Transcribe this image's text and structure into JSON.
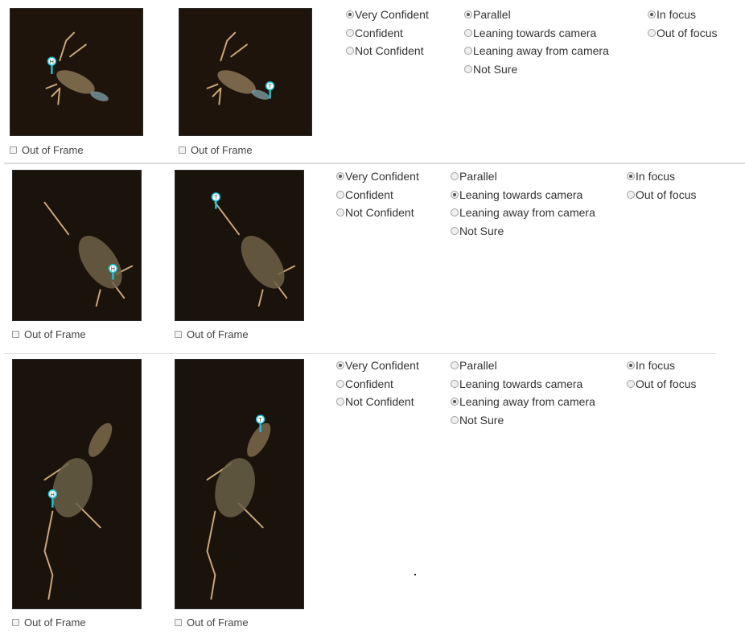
{
  "out_of_frame_label": "Out of Frame",
  "confidence_options": [
    "Very Confident",
    "Confident",
    "Not Confident"
  ],
  "orientation_options": [
    "Parallel",
    "Leaning towards camera",
    "Leaning away from camera",
    "Not Sure"
  ],
  "focus_options": [
    "In focus",
    "Out of focus"
  ],
  "rows": [
    {
      "head_marker": "H",
      "tail_marker": "T",
      "selected": {
        "confidence": "Very Confident",
        "orientation": "Parallel",
        "focus": "In focus"
      },
      "out_of_frame_head": false,
      "out_of_frame_tail": false
    },
    {
      "head_marker": "H",
      "tail_marker": "T",
      "selected": {
        "confidence": "Very Confident",
        "orientation": "Leaning towards camera",
        "focus": "In focus"
      },
      "out_of_frame_head": false,
      "out_of_frame_tail": false
    },
    {
      "head_marker": "H",
      "tail_marker": "T",
      "selected": {
        "confidence": "Very Confident",
        "orientation": "Leaning away from camera",
        "focus": "In focus"
      },
      "out_of_frame_head": false,
      "out_of_frame_tail": false
    }
  ],
  "colors": {
    "marker": "#19c3d6",
    "image_bg": "#1a120a",
    "separator": "#d9d9d9"
  }
}
